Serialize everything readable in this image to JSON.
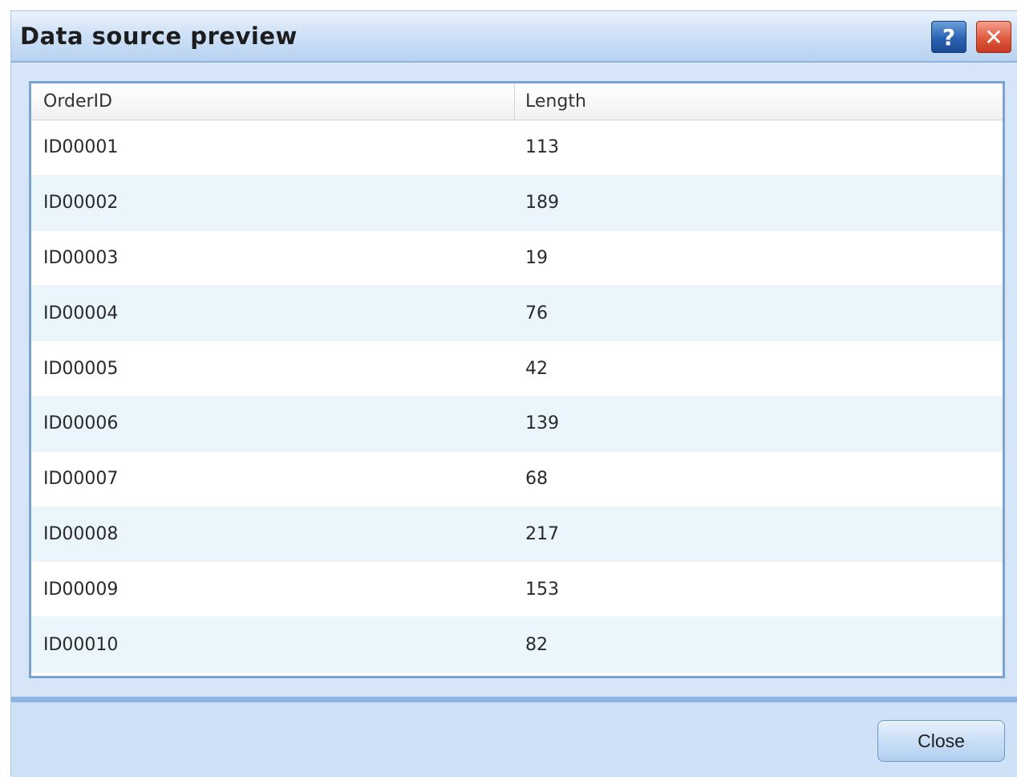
{
  "window": {
    "title": "Data source preview",
    "help_label": "?",
    "close_x_label": "✕"
  },
  "table": {
    "columns": [
      "OrderID",
      "Length"
    ],
    "rows": [
      [
        "ID00001",
        "113"
      ],
      [
        "ID00002",
        "189"
      ],
      [
        "ID00003",
        "19"
      ],
      [
        "ID00004",
        "76"
      ],
      [
        "ID00005",
        "42"
      ],
      [
        "ID00006",
        "139"
      ],
      [
        "ID00007",
        "68"
      ],
      [
        "ID00008",
        "217"
      ],
      [
        "ID00009",
        "153"
      ],
      [
        "ID00010",
        "82"
      ]
    ]
  },
  "footer": {
    "close_label": "Close"
  },
  "colors": {
    "titlebar": "#cfe2f7",
    "alt_row": "#eaf5fc",
    "grid_border": "#7aa3d1",
    "help_button": "#2a63b2",
    "close_button": "#e05a3f"
  },
  "icons": {
    "help": "question-mark-icon",
    "close": "close-icon"
  }
}
